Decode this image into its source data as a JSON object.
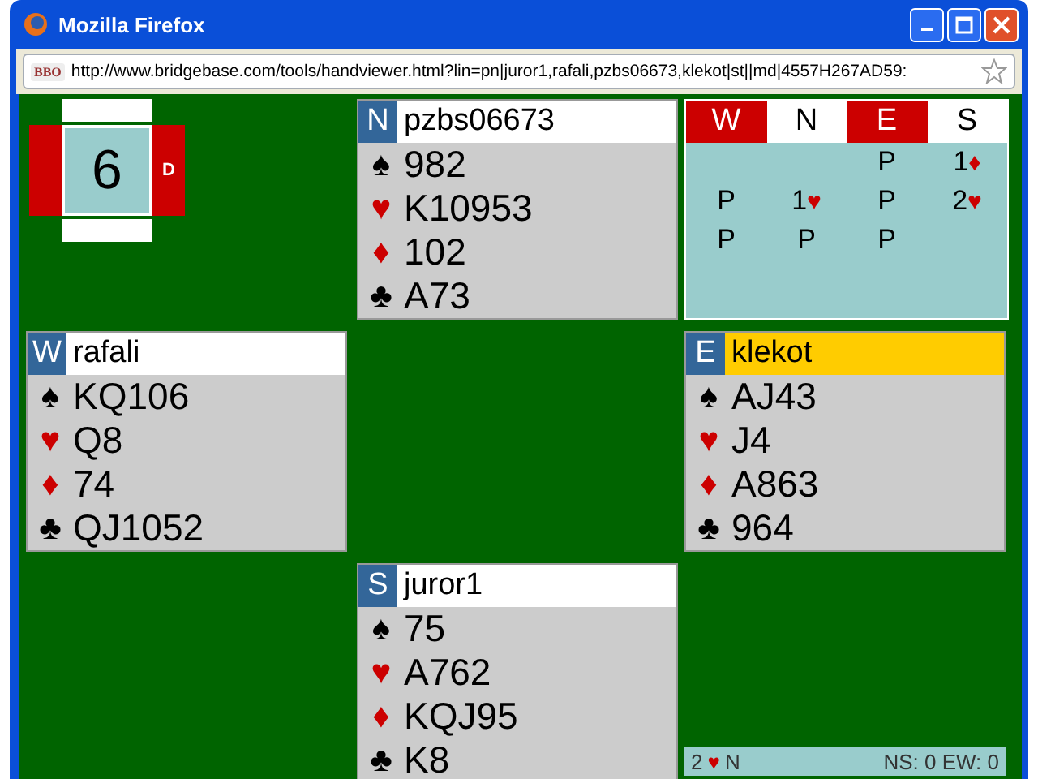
{
  "window": {
    "title": "Mozilla Firefox"
  },
  "address_bar": {
    "site_badge": "BBO",
    "url": "http://www.bridgebase.com/tools/handviewer.html?lin=pn|juror1,rafali,pzbs06673,klekot|st||md|4557H267AD59:"
  },
  "board": {
    "number": "6",
    "dealer_mark": "D",
    "north": {
      "vulnerable": false
    },
    "west": {
      "vulnerable": true
    },
    "east": {
      "vulnerable": true
    },
    "south": {
      "vulnerable": false
    }
  },
  "hands": [
    {
      "seat": "N",
      "player": "pzbs06673",
      "highlighted": false,
      "suits": [
        {
          "symbol": "♠",
          "color": "#000000",
          "cards": "982"
        },
        {
          "symbol": "♥",
          "color": "#cc0000",
          "cards": "K10953"
        },
        {
          "symbol": "♦",
          "color": "#cc0000",
          "cards": "102"
        },
        {
          "symbol": "♣",
          "color": "#000000",
          "cards": "A73"
        }
      ]
    },
    {
      "seat": "W",
      "player": "rafali",
      "highlighted": false,
      "suits": [
        {
          "symbol": "♠",
          "color": "#000000",
          "cards": "KQ106"
        },
        {
          "symbol": "♥",
          "color": "#cc0000",
          "cards": "Q8"
        },
        {
          "symbol": "♦",
          "color": "#cc0000",
          "cards": "74"
        },
        {
          "symbol": "♣",
          "color": "#000000",
          "cards": "QJ1052"
        }
      ]
    },
    {
      "seat": "E",
      "player": "klekot",
      "highlighted": true,
      "suits": [
        {
          "symbol": "♠",
          "color": "#000000",
          "cards": "AJ43"
        },
        {
          "symbol": "♥",
          "color": "#cc0000",
          "cards": "J4"
        },
        {
          "symbol": "♦",
          "color": "#cc0000",
          "cards": "A863"
        },
        {
          "symbol": "♣",
          "color": "#000000",
          "cards": "964"
        }
      ]
    },
    {
      "seat": "S",
      "player": "juror1",
      "highlighted": false,
      "suits": [
        {
          "symbol": "♠",
          "color": "#000000",
          "cards": "75"
        },
        {
          "symbol": "♥",
          "color": "#cc0000",
          "cards": "A762"
        },
        {
          "symbol": "♦",
          "color": "#cc0000",
          "cards": "KQJ95"
        },
        {
          "symbol": "♣",
          "color": "#000000",
          "cards": "K8"
        }
      ]
    }
  ],
  "auction": {
    "columns": [
      {
        "seat": "W",
        "vulnerable": true
      },
      {
        "seat": "N",
        "vulnerable": false
      },
      {
        "seat": "E",
        "vulnerable": true
      },
      {
        "seat": "S",
        "vulnerable": false
      }
    ],
    "calls": [
      {
        "kind": "empty"
      },
      {
        "kind": "empty"
      },
      {
        "kind": "call",
        "text": "P"
      },
      {
        "kind": "bid",
        "text": "1",
        "suit": "♦",
        "color": "#cc0000"
      },
      {
        "kind": "call",
        "text": "P"
      },
      {
        "kind": "bid",
        "text": "1",
        "suit": "♥",
        "color": "#cc0000"
      },
      {
        "kind": "call",
        "text": "P"
      },
      {
        "kind": "bid",
        "text": "2",
        "suit": "♥",
        "color": "#cc0000"
      },
      {
        "kind": "call",
        "text": "P"
      },
      {
        "kind": "call",
        "text": "P"
      },
      {
        "kind": "call",
        "text": "P"
      }
    ]
  },
  "status": {
    "contract_level": "2",
    "contract_suit": "♥",
    "color": "#cc0000",
    "declarer": "N",
    "score": "NS: 0 EW: 0"
  }
}
